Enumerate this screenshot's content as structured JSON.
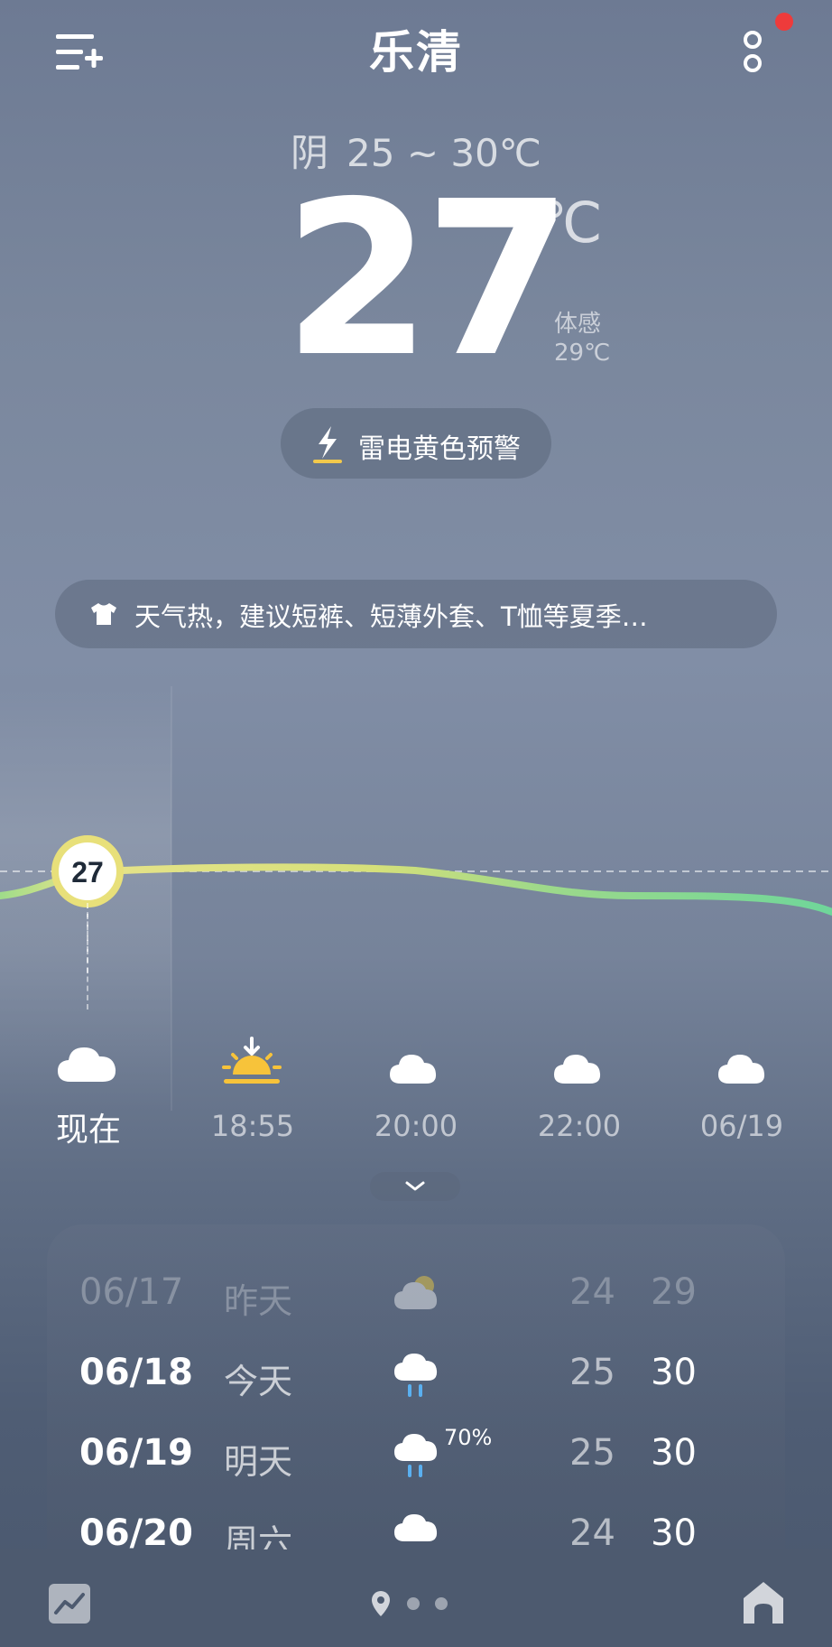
{
  "header": {
    "city": "乐清",
    "menu_icon": "add-city-menu-icon",
    "more_icon": "more-options-icon",
    "notification_color": "#ee3b3b"
  },
  "current": {
    "condition": "阴",
    "range": "25 ~ 30℃",
    "temperature": "27",
    "unit": "℃",
    "feels_label": "体感",
    "feels_value": "29℃"
  },
  "warning": {
    "icon": "lightning-icon",
    "text": "雷电黄色预警",
    "color": "#f2c94c"
  },
  "advice": {
    "icon": "tshirt-icon",
    "text": "天气热，建议短裤、短薄外套、T恤等夏季…"
  },
  "hourly": {
    "now_temp": "27",
    "items": [
      {
        "label": "现在",
        "icon": "cloudy-icon"
      },
      {
        "label": "18:55",
        "icon": "sunset-icon"
      },
      {
        "label": "20:00",
        "icon": "partly-cloudy-night-icon"
      },
      {
        "label": "22:00",
        "icon": "partly-cloudy-night-icon"
      },
      {
        "label": "06/19",
        "icon": "partly-cloudy-night-icon"
      }
    ],
    "expand_icon": "chevron-down-icon"
  },
  "daily": [
    {
      "date": "06/17",
      "day": "昨天",
      "icon": "partly-cloudy-day-icon",
      "pop": "",
      "low": "24",
      "high": "29",
      "past": true
    },
    {
      "date": "06/18",
      "day": "今天",
      "icon": "rain-icon",
      "pop": "",
      "low": "25",
      "high": "30",
      "past": false
    },
    {
      "date": "06/19",
      "day": "明天",
      "icon": "rain-icon",
      "pop": "70%",
      "low": "25",
      "high": "30",
      "past": false
    },
    {
      "date": "06/20",
      "day": "周六",
      "icon": "cloudy-icon",
      "pop": "",
      "low": "24",
      "high": "30",
      "past": false
    }
  ],
  "bottom": {
    "trend_icon": "trend-chart-icon",
    "location_icon": "location-pin-icon",
    "home_icon": "home-icon"
  }
}
